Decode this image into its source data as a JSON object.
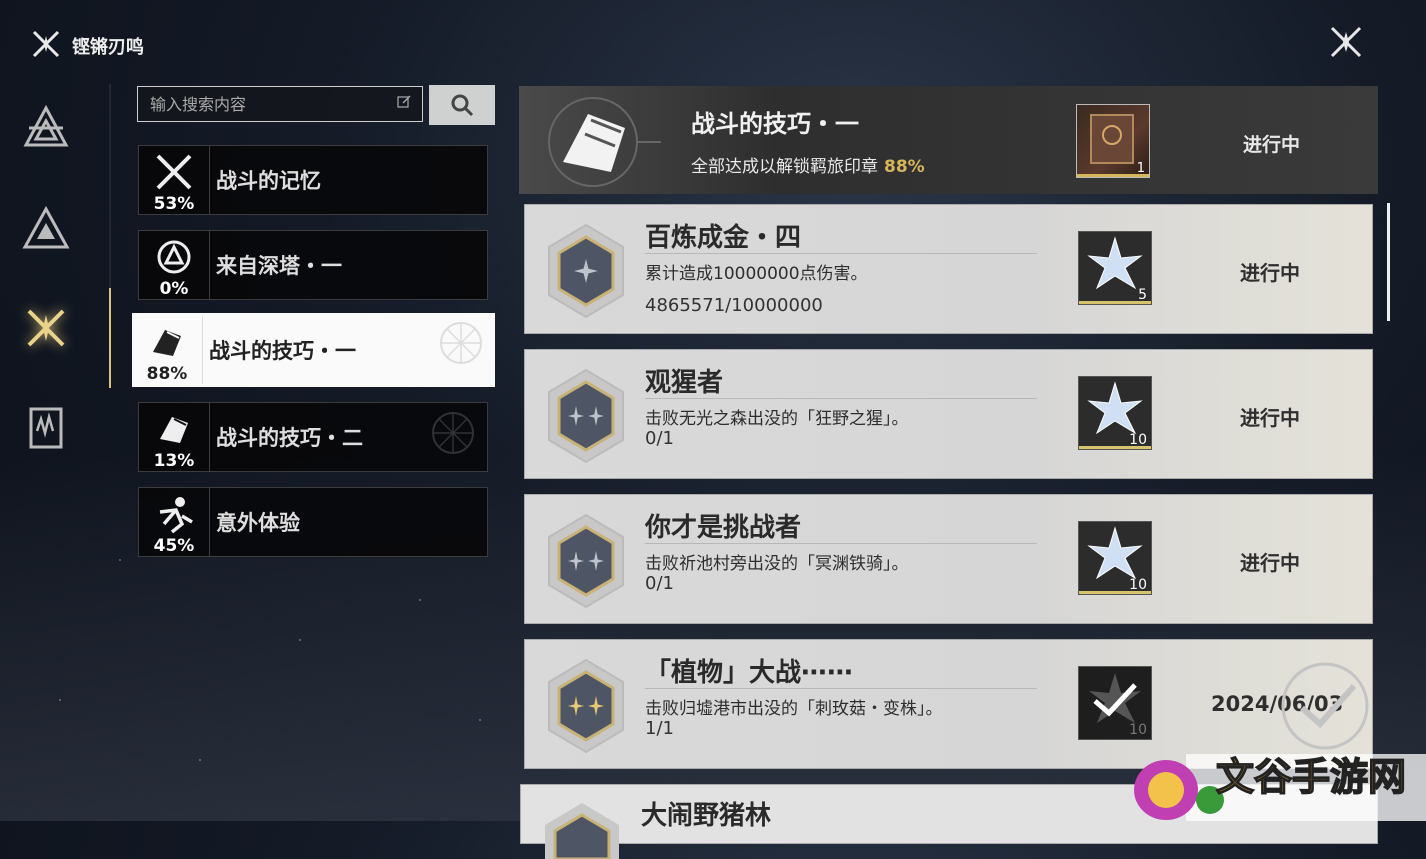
{
  "app": {
    "title": "铿锵刃鸣"
  },
  "search": {
    "placeholder": "输入搜索内容"
  },
  "nav": {
    "items": [
      "nav-1",
      "nav-2",
      "nav-3-active",
      "nav-4"
    ]
  },
  "categories": [
    {
      "label": "战斗的记忆",
      "pct": "53%"
    },
    {
      "label": "来自深塔・一",
      "pct": "0%"
    },
    {
      "label": "战斗的技巧・一",
      "pct": "88%"
    },
    {
      "label": "战斗的技巧・二",
      "pct": "13%"
    },
    {
      "label": "意外体验",
      "pct": "45%"
    }
  ],
  "header": {
    "title": "战斗的技巧・一",
    "subtitle": "全部达成以解锁羁旅印章",
    "pct": "88%",
    "reward_count": "1",
    "status": "进行中"
  },
  "achievements": [
    {
      "title": "百炼成金・四",
      "desc": "累计造成10000000点伤害。",
      "progress": "4865571/10000000",
      "reward_count": "5",
      "status": "进行中",
      "stars": 1
    },
    {
      "title": "观猩者",
      "desc": "击败无光之森出没的「狂野之猩」。",
      "progress": "0/1",
      "reward_count": "10",
      "status": "进行中",
      "stars": 2
    },
    {
      "title": "你才是挑战者",
      "desc": "击败祈池村旁出没的「冥渊铁骑」。",
      "progress": "0/1",
      "reward_count": "10",
      "status": "进行中",
      "stars": 2
    },
    {
      "title": "「植物」大战⋯⋯",
      "desc": "击败归墟港市出没的「刺玫菇・变株」。",
      "progress": "1/1",
      "reward_count": "10",
      "date": "2024/06/03",
      "stars": 2
    },
    {
      "title": "大闹野猪林"
    }
  ],
  "watermark": {
    "text": "文谷手游网"
  },
  "colors": {
    "accent_gold": "#d7b55b",
    "active_bg": "#fafafa"
  }
}
